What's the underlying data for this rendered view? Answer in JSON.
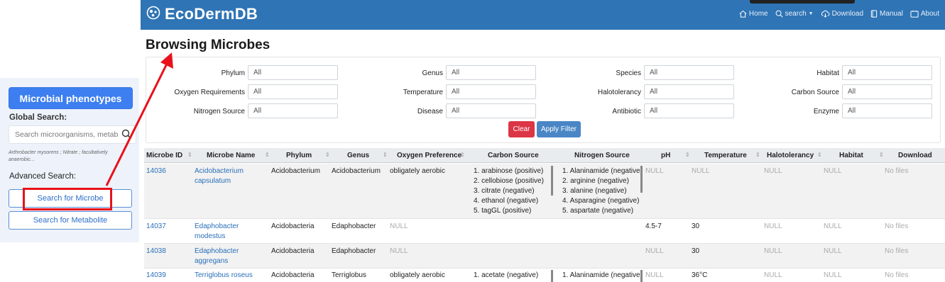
{
  "side": {
    "phenotypes_button": "Microbial phenotypes",
    "global_search_label": "Global Search:",
    "search_placeholder": "Search microorganisms, metab",
    "search_hint": "Arthrobacter mysorens ; Nitrate ; facultatively anaerobic...",
    "advanced_label": "Advanced Search:",
    "search_microbe": "Search for Microbe",
    "search_metabolite": "Search for Metabolite"
  },
  "nav": {
    "brand": "EcoDermDB",
    "links": [
      {
        "label": "Home",
        "icon": "home-icon"
      },
      {
        "label": "search",
        "icon": "search-icon"
      },
      {
        "label": "Download",
        "icon": "cloud-download-icon"
      },
      {
        "label": "Manual",
        "icon": "book-icon"
      },
      {
        "label": "About",
        "icon": "info-icon"
      }
    ]
  },
  "page_title": "Browsing Microbes",
  "filters": [
    {
      "label": "Phylum",
      "value": "All"
    },
    {
      "label": "Genus",
      "value": "All"
    },
    {
      "label": "Species",
      "value": "All"
    },
    {
      "label": "Habitat",
      "value": "All"
    },
    {
      "label": "Oxygen Requirements",
      "value": "All"
    },
    {
      "label": "Temperature",
      "value": "All"
    },
    {
      "label": "Halotolerancy",
      "value": "All"
    },
    {
      "label": "Carbon Source",
      "value": "All"
    },
    {
      "label": "Nitrogen Source",
      "value": "All"
    },
    {
      "label": "Disease",
      "value": "All"
    },
    {
      "label": "Antibiotic",
      "value": "All"
    },
    {
      "label": "Enzyme",
      "value": "All"
    }
  ],
  "buttons": {
    "clear": "Clear",
    "apply": "Apply Filter"
  },
  "table": {
    "headers": [
      "Microbe ID",
      "Microbe Name",
      "Phylum",
      "Genus",
      "Oxygen Preference",
      "Carbon Source",
      "Nitrogen Source",
      "pH",
      "Temperature",
      "Halotolerancy",
      "Habitat",
      "Download"
    ],
    "rows": [
      {
        "id": "14036",
        "name": [
          "Acidobacterium",
          "capsulatum"
        ],
        "phylum": "Acidobacterium",
        "genus": "Acidobacterium",
        "oxygen": "obligately aerobic",
        "carbon": [
          "1. arabinose (positive)",
          "2. cellobiose (positive)",
          "3. citrate (negative)",
          "4. ethanol (negative)",
          "5. tagGL (positive)"
        ],
        "nitrogen": [
          "1. Alaninamide (negative)",
          "2. arginine (negative)",
          "3. alanine (negative)",
          "4. Asparagine (negative)",
          "5. aspartate (negative)"
        ],
        "ph": "NULL",
        "temp": "NULL",
        "halo": "NULL",
        "habitat": "NULL",
        "download": "No files"
      },
      {
        "id": "14037",
        "name": [
          "Edaphobacter",
          "modestus"
        ],
        "phylum": "Acidobacteria",
        "genus": "Edaphobacter",
        "oxygen": "NULL",
        "carbon": [],
        "nitrogen": [],
        "ph": "4.5-7",
        "temp": "30",
        "halo": "NULL",
        "habitat": "NULL",
        "download": "No files"
      },
      {
        "id": "14038",
        "name": [
          "Edaphobacter",
          "aggregans"
        ],
        "phylum": "Acidobacteria",
        "genus": "Edaphobacter",
        "oxygen": "NULL",
        "carbon": [],
        "nitrogen": [],
        "ph": "NULL",
        "temp": "30",
        "halo": "NULL",
        "habitat": "NULL",
        "download": "No files"
      },
      {
        "id": "14039",
        "name": [
          "Terriglobus roseus"
        ],
        "phylum": "Acidobacteria",
        "genus": "Terriglobus",
        "oxygen": "obligately aerobic",
        "carbon": [
          "1. acetate (negative)"
        ],
        "nitrogen": [
          "1. Alaninamide (negative)"
        ],
        "ph": "NULL",
        "temp": "36°C",
        "halo": "NULL",
        "habitat": "NULL",
        "download": "No files"
      }
    ]
  },
  "colors": {
    "navbar": "#2f74b5",
    "accent": "#3d7ff0",
    "danger": "#dc3545",
    "annotation": "#e8111a"
  }
}
